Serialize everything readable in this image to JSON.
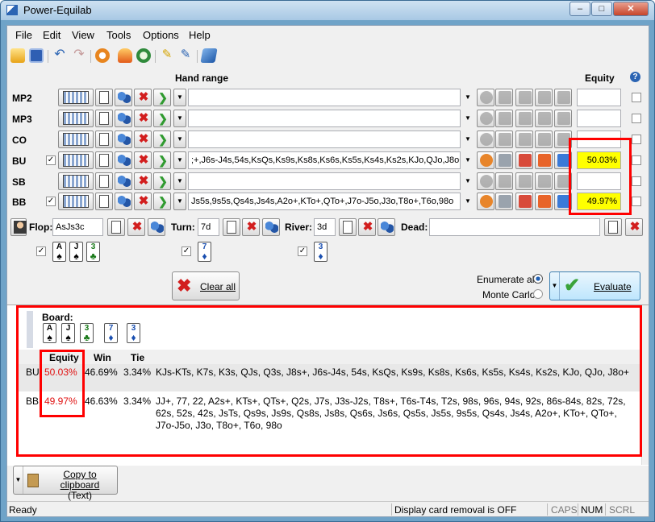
{
  "window": {
    "title": "Power-Equilab",
    "min": "–",
    "max": "□",
    "close": "✕"
  },
  "menu": [
    "File",
    "Edit",
    "View",
    "Tools",
    "Options",
    "Help"
  ],
  "header": {
    "hand_range": "Hand range",
    "equity": "Equity",
    "help": "?"
  },
  "players": [
    {
      "label": "MP2",
      "range": "",
      "equity": "",
      "checked": false
    },
    {
      "label": "MP3",
      "range": "",
      "equity": "",
      "checked": false
    },
    {
      "label": "CO",
      "range": "",
      "equity": "",
      "checked": false
    },
    {
      "label": "BU",
      "range": ";+,J6s-J4s,54s,KsQs,Ks9s,Ks8s,Ks6s,Ks5s,Ks4s,Ks2s,KJo,QJo,J8o+",
      "equity": "50.03%",
      "checked": true
    },
    {
      "label": "SB",
      "range": "",
      "equity": "",
      "checked": false
    },
    {
      "label": "BB",
      "range": "Js5s,9s5s,Qs4s,Js4s,A2o+,KTo+,QTo+,J7o-J5o,J3o,T8o+,T6o,98o",
      "equity": "49.97%",
      "checked": true
    }
  ],
  "board_inputs": {
    "flop_label": "Flop:",
    "flop_value": "AsJs3c",
    "turn_label": "Turn:",
    "turn_value": "7d",
    "river_label": "River:",
    "river_value": "3d",
    "dead_label": "Dead:",
    "dead_value": ""
  },
  "board_cards": [
    {
      "rank": "A",
      "suit": "♠",
      "color": "#000000"
    },
    {
      "rank": "J",
      "suit": "♠",
      "color": "#000000"
    },
    {
      "rank": "3",
      "suit": "♣",
      "color": "#1a7a1a"
    },
    {
      "rank": "7",
      "suit": "♦",
      "color": "#1a4fb0"
    },
    {
      "rank": "3",
      "suit": "♦",
      "color": "#1a4fb0"
    }
  ],
  "controls": {
    "clear_all": "Clear all",
    "enumerate_all": "Enumerate all",
    "monte_carlo": "Monte Carlo",
    "evaluate": "Evaluate"
  },
  "results": {
    "board_label": "Board:",
    "columns": [
      "Equity",
      "Win",
      "Tie"
    ],
    "rows": [
      {
        "player": "BU",
        "equity": "50.03%",
        "win": "46.69%",
        "tie": "3.34%",
        "range": "KJs-KTs, K7s, K3s, QJs, Q3s, J8s+, J6s-J4s, 54s, KsQs, Ks9s, Ks8s, Ks6s, Ks5s, Ks4s, Ks2s, KJo, QJo, J8o+"
      },
      {
        "player": "BB",
        "equity": "49.97%",
        "win": "46.63%",
        "tie": "3.34%",
        "range": "JJ+, 77, 22, A2s+, KTs+, QTs+, Q2s, J7s, J3s-J2s, T8s+, T6s-T4s, T2s, 98s, 96s, 94s, 92s, 86s-84s, 82s, 72s, 62s, 52s, 42s, JsTs, Qs9s, Js9s, Qs8s, Js8s, Qs6s, Js6s, Qs5s, Js5s, 9s5s, Qs4s, Js4s, A2o+, KTo+, QTo+, J7o-J5o, J3o, T8o+, T6o, 98o"
      }
    ]
  },
  "copy_button": "Copy to clipboard\n(Text)",
  "copy_line1": "Copy to clipboard",
  "copy_line2": "(Text)",
  "status": {
    "ready": "Ready",
    "card_removal": "Display card removal is OFF",
    "caps": "CAPS",
    "num": "NUM",
    "scrl": "SCRL"
  },
  "colors": {
    "highlight": "#ff0000",
    "equity_fill": "#ffff00"
  }
}
